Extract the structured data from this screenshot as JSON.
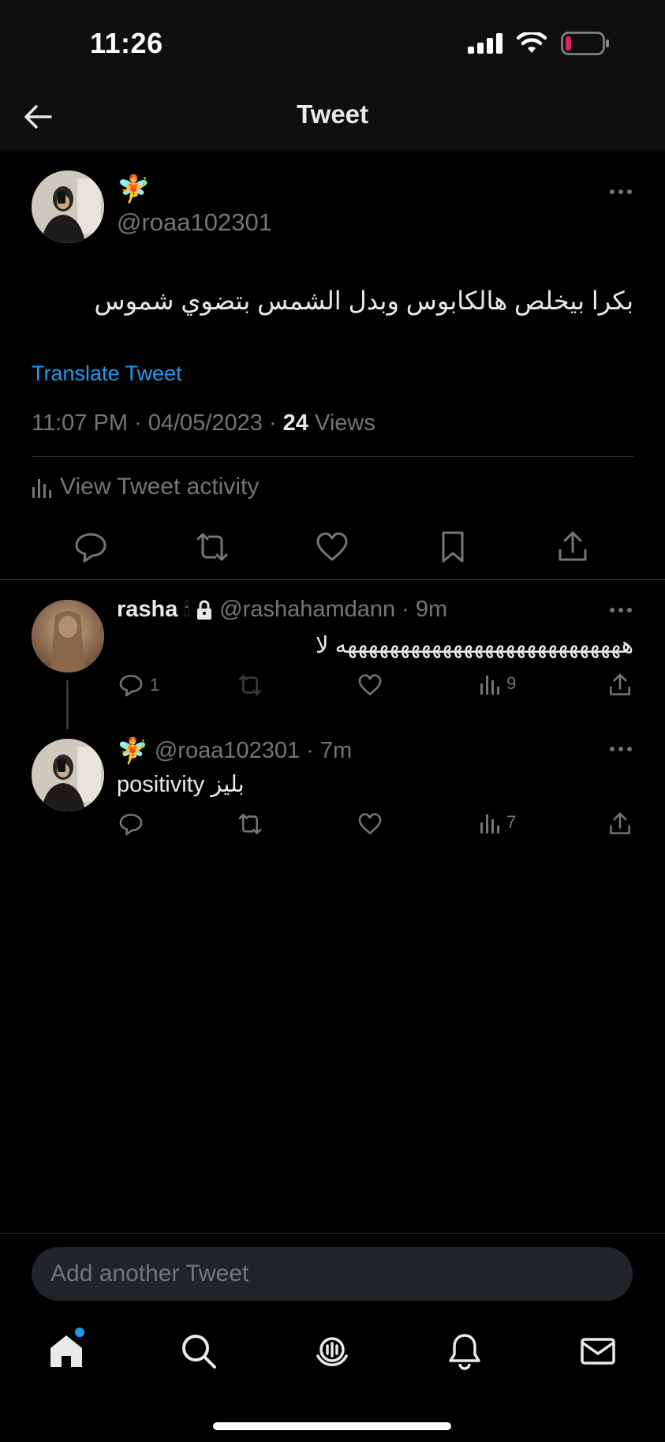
{
  "status_bar": {
    "time": "11:26",
    "battery_color": "#e0245e"
  },
  "header": {
    "title": "Tweet",
    "back_icon": "arrow-left-icon"
  },
  "main_tweet": {
    "display_name_emoji": "🧚",
    "handle": "@roaa102301",
    "text": "بكرا بيخلص هالكابوس وبدل الشمس بتضوي شموس",
    "translate_label": "Translate Tweet",
    "meta": {
      "datetime": "11:07 PM · 04/05/2023 · ",
      "views_count": "24",
      "views_label": " Views"
    },
    "activity_label": "View Tweet activity",
    "actions": [
      "reply-icon",
      "retweet-icon",
      "like-icon",
      "bookmark-icon",
      "share-icon"
    ]
  },
  "replies": [
    {
      "display_name": "rasha",
      "name_suffix": "🕯",
      "handle": "@rashahamdann",
      "time": "· 9m",
      "text": "هههههههههههههههههههههههههههه لا",
      "reply_count": "1",
      "view_count": "9"
    },
    {
      "display_name_emoji": "🧚",
      "handle": "@roaa102301",
      "time": "· 7m",
      "text": "positivity بليز",
      "view_count": "7"
    }
  ],
  "compose": {
    "placeholder": "Add another Tweet"
  },
  "bottom_nav": [
    "home-icon",
    "search-icon",
    "spaces-icon",
    "notifications-icon",
    "messages-icon"
  ],
  "colors": {
    "accent": "#1d9bf0",
    "muted": "#71767b",
    "text": "#e7e9ea",
    "background": "#000000"
  }
}
